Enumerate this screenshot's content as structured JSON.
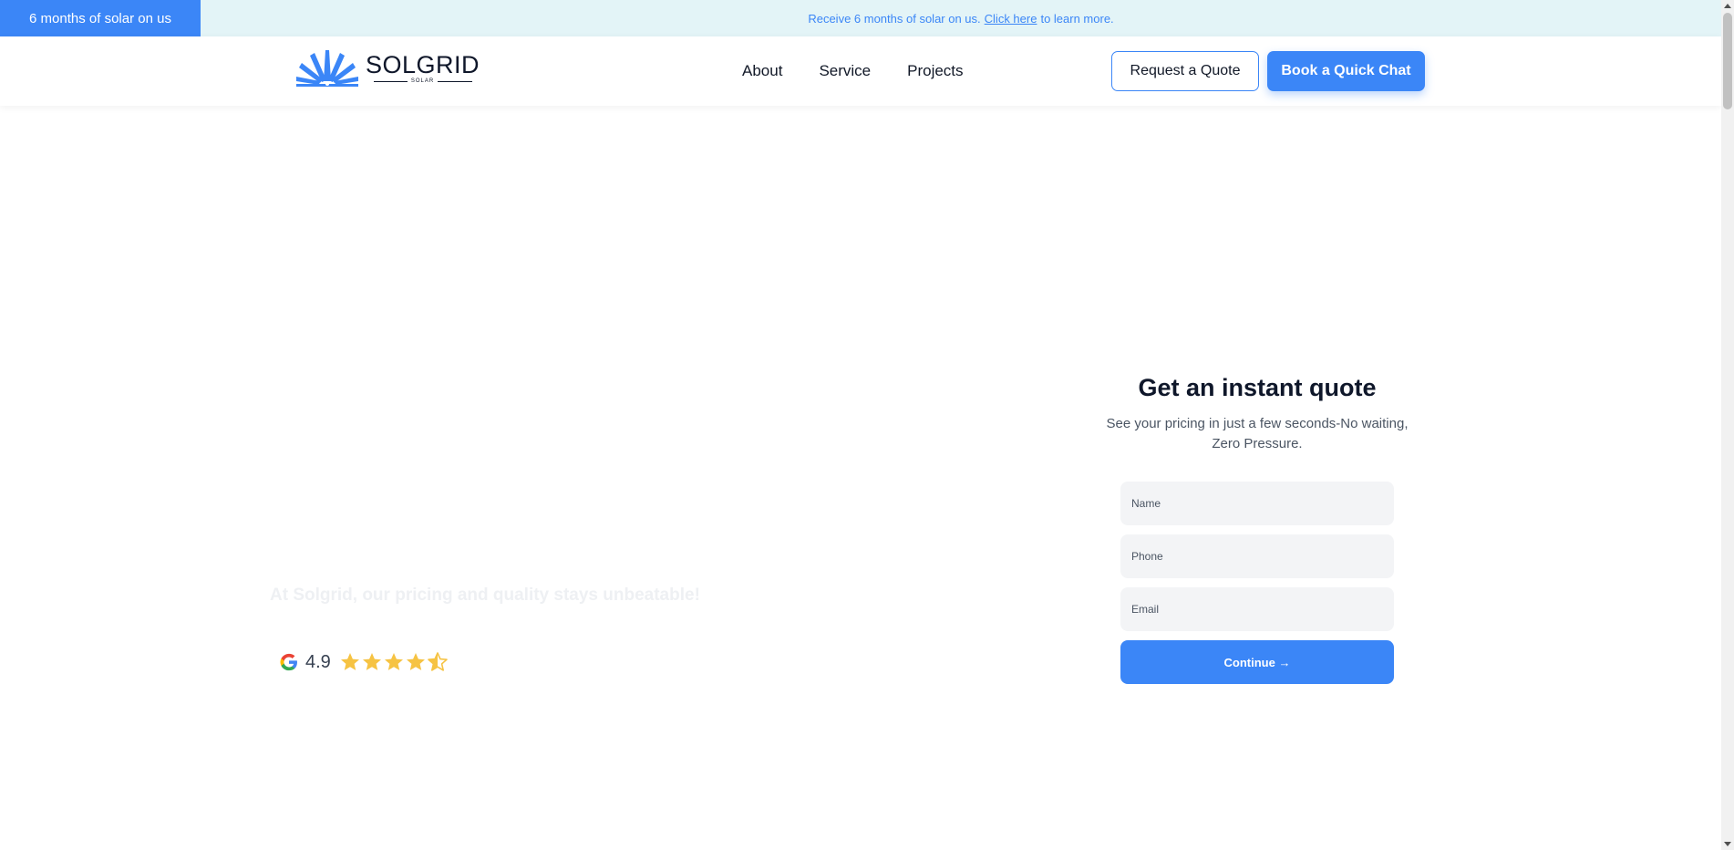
{
  "promo": {
    "tag": "6 months of solar on us",
    "message_prefix": "Receive 6 months of solar on us.",
    "link": "Click here",
    "message_suffix": "to learn more."
  },
  "header": {
    "logo_name": "SOLGRID",
    "logo_sub": "SOLAR",
    "nav": [
      "About",
      "Service",
      "Projects"
    ],
    "request_quote": "Request a Quote",
    "book_chat": "Book a Quick Chat"
  },
  "hero": {
    "tagline": "At Solgrid, our pricing and quality stays unbeatable!",
    "rating_value": "4.9",
    "rating": 4.5,
    "rating_max": 5
  },
  "quote_form": {
    "title": "Get an instant quote",
    "subtitle": "See your pricing in just a few seconds-No waiting, Zero Pressure.",
    "name_placeholder": "Name",
    "phone_placeholder": "Phone",
    "email_placeholder": "Email",
    "continue_label": "Continue →"
  },
  "colors": {
    "accent": "#3b86f7",
    "promo_bg": "#e3f4f7",
    "star": "#f6c343"
  },
  "icons": [
    "sun-logo-icon",
    "google-icon",
    "star-icon",
    "half-star-icon"
  ]
}
